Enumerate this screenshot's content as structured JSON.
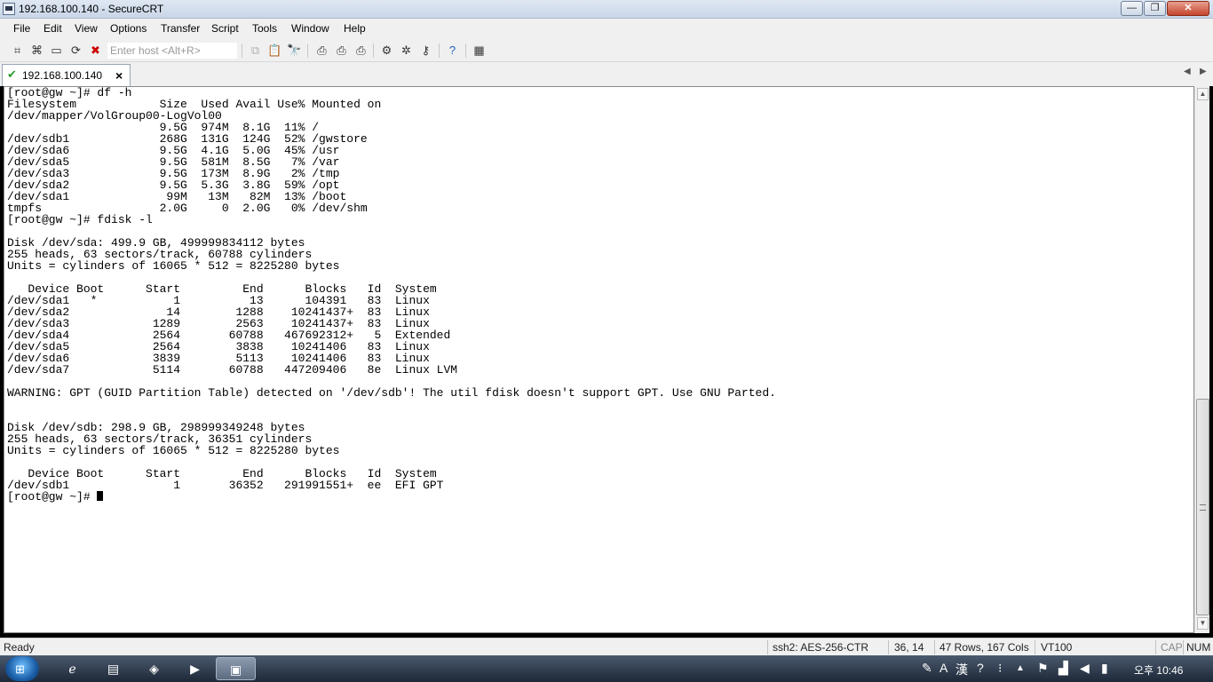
{
  "window": {
    "title": "192.168.100.140 - SecureCRT",
    "buttons": {
      "minimize": "—",
      "maximize": "❐",
      "close": "✕"
    }
  },
  "menu": [
    "File",
    "Edit",
    "View",
    "Options",
    "Transfer",
    "Script",
    "Tools",
    "Window",
    "Help"
  ],
  "toolbar": {
    "host_placeholder": "Enter host <Alt+R>",
    "icons": [
      "connect-icon",
      "quick-connect-icon",
      "connect-tab-icon",
      "reconnect-icon",
      "disconnect-icon",
      "copy-icon",
      "paste-icon",
      "find-icon",
      "print-screen-icon",
      "print-selection-icon",
      "print-icon",
      "session-options-icon",
      "global-options-icon",
      "keymap-icon",
      "help-icon",
      "sftp-icon"
    ]
  },
  "tab": {
    "label": "192.168.100.140",
    "close": "×",
    "nav_left": "◀",
    "nav_right": "▶"
  },
  "terminal": {
    "lines": [
      "[root@gw ~]# df -h",
      "Filesystem            Size  Used Avail Use% Mounted on",
      "/dev/mapper/VolGroup00-LogVol00",
      "                      9.5G  974M  8.1G  11% /",
      "/dev/sdb1             268G  131G  124G  52% /gwstore",
      "/dev/sda6             9.5G  4.1G  5.0G  45% /usr",
      "/dev/sda5             9.5G  581M  8.5G   7% /var",
      "/dev/sda3             9.5G  173M  8.9G   2% /tmp",
      "/dev/sda2             9.5G  5.3G  3.8G  59% /opt",
      "/dev/sda1              99M   13M   82M  13% /boot",
      "tmpfs                 2.0G     0  2.0G   0% /dev/shm",
      "[root@gw ~]# fdisk -l",
      "",
      "Disk /dev/sda: 499.9 GB, 499999834112 bytes",
      "255 heads, 63 sectors/track, 60788 cylinders",
      "Units = cylinders of 16065 * 512 = 8225280 bytes",
      "",
      "   Device Boot      Start         End      Blocks   Id  System",
      "/dev/sda1   *           1          13      104391   83  Linux",
      "/dev/sda2              14        1288    10241437+  83  Linux",
      "/dev/sda3            1289        2563    10241437+  83  Linux",
      "/dev/sda4            2564       60788   467692312+   5  Extended",
      "/dev/sda5            2564        3838    10241406   83  Linux",
      "/dev/sda6            3839        5113    10241406   83  Linux",
      "/dev/sda7            5114       60788   447209406   8e  Linux LVM",
      "",
      "WARNING: GPT (GUID Partition Table) detected on '/dev/sdb'! The util fdisk doesn't support GPT. Use GNU Parted.",
      "",
      "",
      "Disk /dev/sdb: 298.9 GB, 298999349248 bytes",
      "255 heads, 63 sectors/track, 36351 cylinders",
      "Units = cylinders of 16065 * 512 = 8225280 bytes",
      "",
      "   Device Boot      Start         End      Blocks   Id  System",
      "/dev/sdb1               1       36352   291991551+  ee  EFI GPT"
    ],
    "prompt": "[root@gw ~]# "
  },
  "status": {
    "ready": "Ready",
    "cipher": "ssh2: AES-256-CTR",
    "position": "36, 14",
    "size": "47 Rows, 167 Cols",
    "emulation": "VT100",
    "caps": "CAP",
    "num": "NUM"
  },
  "taskbar": {
    "tray_ime_a": "A",
    "tray_ime_han": "漢",
    "clock": "오후 10:46"
  }
}
